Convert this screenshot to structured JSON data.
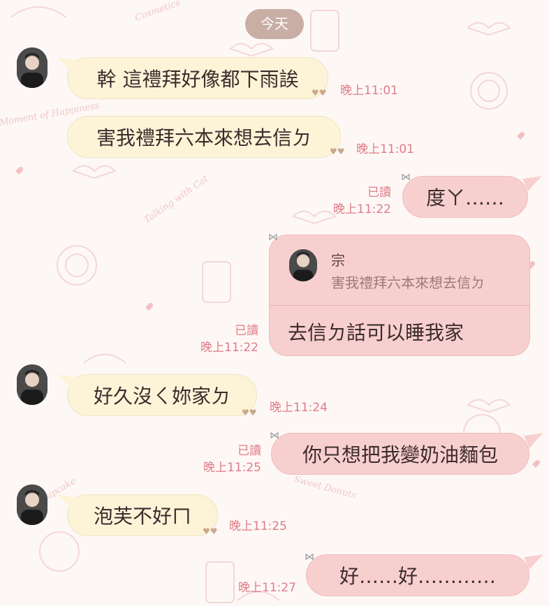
{
  "date_label": "今天",
  "quote": {
    "name": "宗",
    "text": "害我禮拜六本來想去信ㄉ"
  },
  "messages": [
    {
      "text": "幹 這禮拜好像都下雨誒",
      "time": "晚上11:01"
    },
    {
      "text": "害我禮拜六本來想去信ㄉ",
      "time": "晚上11:01"
    },
    {
      "text": "度ㄚ……",
      "read": "已讀",
      "time": "晚上11:22"
    },
    {
      "text": "去信ㄉ話可以睡我家",
      "read": "已讀",
      "time": "晚上11:22"
    },
    {
      "text": "好久沒ㄑ妳家ㄉ",
      "time": "晚上11:24"
    },
    {
      "text": "你只想把我變奶油麵包",
      "read": "已讀",
      "time": "晚上11:25"
    },
    {
      "text": "泡芙不好ㄇ",
      "time": "晚上11:25"
    },
    {
      "text": "好……好…………",
      "time": "晚上11:27"
    }
  ],
  "wallpaper_text": [
    "Cosmetics",
    "Moment of Happiness",
    "Talking with Cat",
    "Sweet Donuts",
    "Cupcake"
  ],
  "colors": {
    "background": "#fdf8f6",
    "incoming_bubble": "#fdf4d8",
    "outgoing_bubble": "#f8cfcf",
    "time_text": "#e07b86",
    "date_pill": "#c9aea6"
  }
}
